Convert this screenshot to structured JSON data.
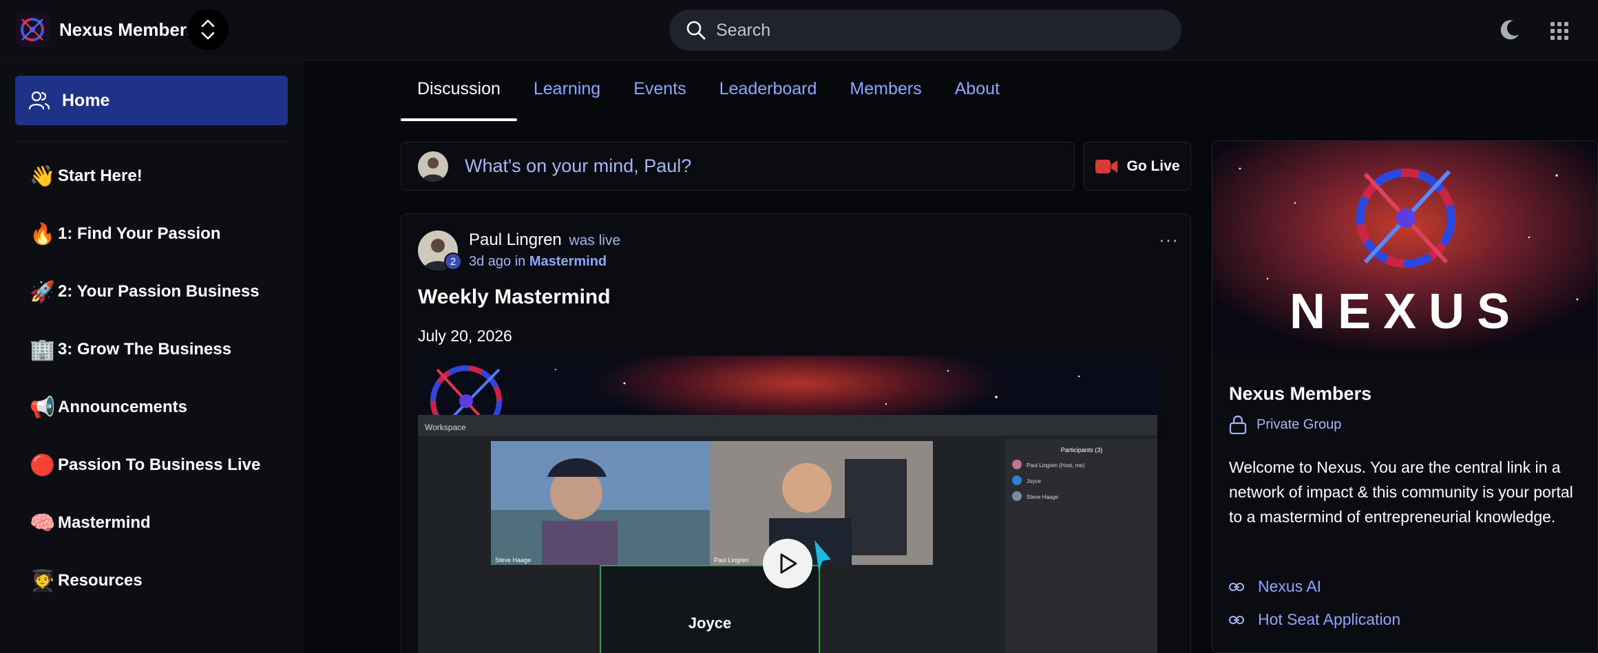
{
  "header": {
    "app_name": "Nexus Members",
    "search_placeholder": "Search",
    "icons": [
      "nexus-logo",
      "switcher-chevrons-icon",
      "search-icon",
      "moon-icon",
      "apps-grid-icon"
    ]
  },
  "sidebar": {
    "home_label": "Home",
    "items": [
      {
        "emoji": "👋",
        "label": "Start Here!"
      },
      {
        "emoji": "🔥",
        "label": "1: Find Your Passion"
      },
      {
        "emoji": "🚀",
        "label": "2: Your Passion Business"
      },
      {
        "emoji": "🏢",
        "label": "3: Grow The Business"
      },
      {
        "emoji": "📢",
        "label": "Announcements"
      },
      {
        "emoji": "🔴",
        "label": "Passion To Business Live"
      },
      {
        "emoji": "🧠",
        "label": "Mastermind"
      },
      {
        "emoji": "🧑‍🎓",
        "label": "Resources"
      }
    ]
  },
  "tabs": [
    {
      "label": "Discussion",
      "active": true
    },
    {
      "label": "Learning",
      "active": false
    },
    {
      "label": "Events",
      "active": false
    },
    {
      "label": "Leaderboard",
      "active": false
    },
    {
      "label": "Members",
      "active": false
    },
    {
      "label": "About",
      "active": false
    }
  ],
  "composer": {
    "prompt": "What's on your mind, Paul?",
    "go_live_label": "Go Live"
  },
  "post": {
    "author": "Paul Lingren",
    "status": "was live",
    "badge_level": "2",
    "time": "3d ago",
    "in_word": "in",
    "group": "Mastermind",
    "menu_glyph": "···",
    "title": "Weekly Mastermind",
    "date": "July 20, 2026",
    "media": {
      "window_label": "Workspace",
      "participants_title": "Participants (3)",
      "participants": [
        "Paul Lingren (Host, me)",
        "Joyce",
        "Steve Haage"
      ],
      "tile_labels": [
        "Steve Haage",
        "Paul Lingren"
      ],
      "speaker_name": "Joyce"
    }
  },
  "group_card": {
    "banner_text": "NEXUS",
    "name": "Nexus Members",
    "privacy": "Private Group",
    "description": "Welcome to Nexus. You are the central link in a network of impact & this community is your portal to a mastermind of entrepreneurial knowledge.",
    "links": [
      "Nexus AI",
      "Hot Seat Application"
    ]
  },
  "colors": {
    "accent": "#8fa6ff",
    "home_active": "#1e3287",
    "background": "#07080c",
    "panel": "#0d0e14",
    "live_red": "#d83a34"
  }
}
